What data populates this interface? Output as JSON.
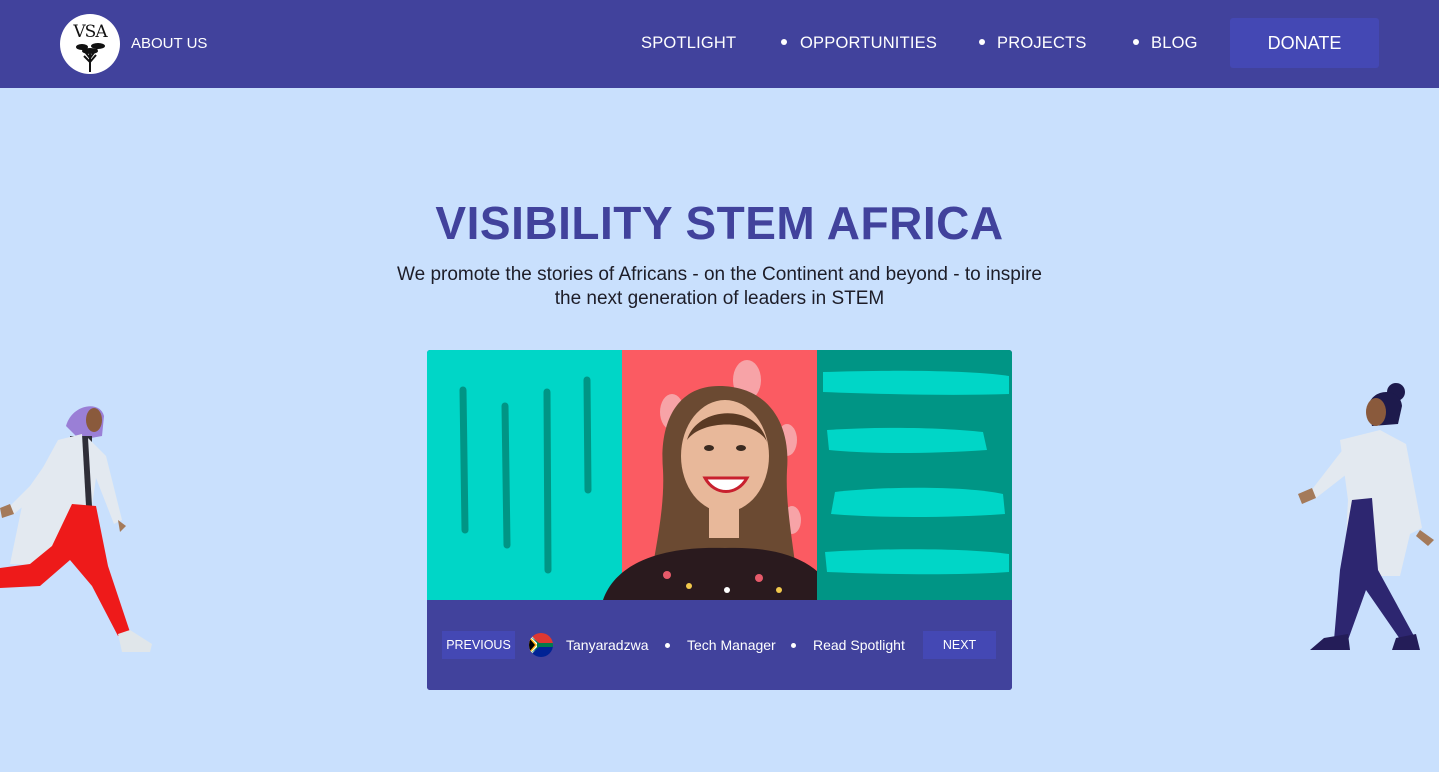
{
  "header": {
    "logo_text": "VSA",
    "about_label": "ABOUT US",
    "nav": [
      {
        "label": "SPOTLIGHT"
      },
      {
        "label": "OPPORTUNITIES"
      },
      {
        "label": "PROJECTS"
      },
      {
        "label": "BLOG"
      }
    ],
    "donate_label": "DONATE"
  },
  "hero": {
    "title": "VISIBILITY STEM AFRICA",
    "subtitle": "We promote the stories of Africans - on the Continent and beyond - to inspire the next generation of leaders in STEM"
  },
  "spotlight": {
    "previous_label": "PREVIOUS",
    "name": "Tanyaradzwa",
    "role": "Tech Manager",
    "read_label": "Read Spotlight",
    "next_label": "NEXT",
    "flag_icon": "south-africa-flag-icon"
  },
  "colors": {
    "header_bg": "#41429c",
    "page_bg": "#c9e0fd",
    "button_bg": "#4448b4",
    "title": "#41429c",
    "teal": "#00d6c7",
    "coral": "#fb5b62",
    "dark_teal": "#009585"
  }
}
